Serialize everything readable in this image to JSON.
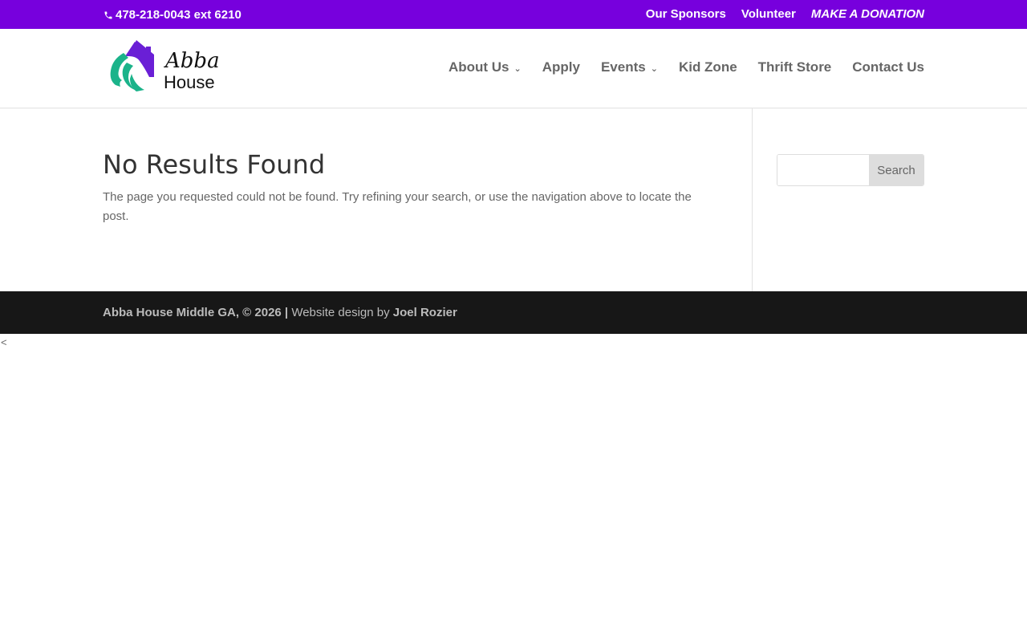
{
  "topbar": {
    "phone": "478-218-0043 ext 6210",
    "links": {
      "sponsors": "Our Sponsors",
      "volunteer": "Volunteer",
      "donate": "MAKE A DONATION"
    }
  },
  "header": {
    "logo_text_line1": "Abba",
    "logo_text_line2": "House",
    "nav": {
      "about": "About Us",
      "apply": "Apply",
      "events": "Events",
      "kidzone": "Kid Zone",
      "thrift": "Thrift Store",
      "contact": "Contact Us"
    }
  },
  "main": {
    "title": "No Results Found",
    "message": "The page you requested could not be found. Try refining your search, or use the navigation above to locate the post."
  },
  "sidebar": {
    "search_placeholder": "",
    "search_button": "Search"
  },
  "footer": {
    "org": "Abba House Middle GA, © 2026 |",
    "design_prefix": "Website design by",
    "designer": "Joel Rozier"
  },
  "stray_char": "<",
  "colors": {
    "topbar": "#7700dd",
    "footer": "#171717",
    "logo_purple": "#6a1fd6",
    "logo_teal": "#1bb38a"
  }
}
